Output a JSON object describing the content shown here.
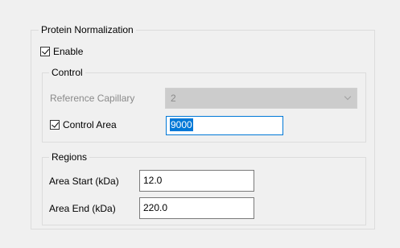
{
  "protein_normalization": {
    "group_title": "Protein Normalization",
    "enable": {
      "label": "Enable",
      "checked": true
    }
  },
  "control": {
    "group_title": "Control",
    "reference_capillary": {
      "label": "Reference Capillary",
      "value": "2",
      "enabled": false
    },
    "control_area": {
      "label": "Control Area",
      "checked": true,
      "value": "9000"
    }
  },
  "regions": {
    "group_title": "Regions",
    "area_start": {
      "label": "Area Start (kDa)",
      "value": "12.0"
    },
    "area_end": {
      "label": "Area End (kDa)",
      "value": "220.0"
    }
  },
  "colors": {
    "window_background": "#f0f0f0",
    "selection_highlight": "#0078d7",
    "focus_border": "#0078d7"
  }
}
